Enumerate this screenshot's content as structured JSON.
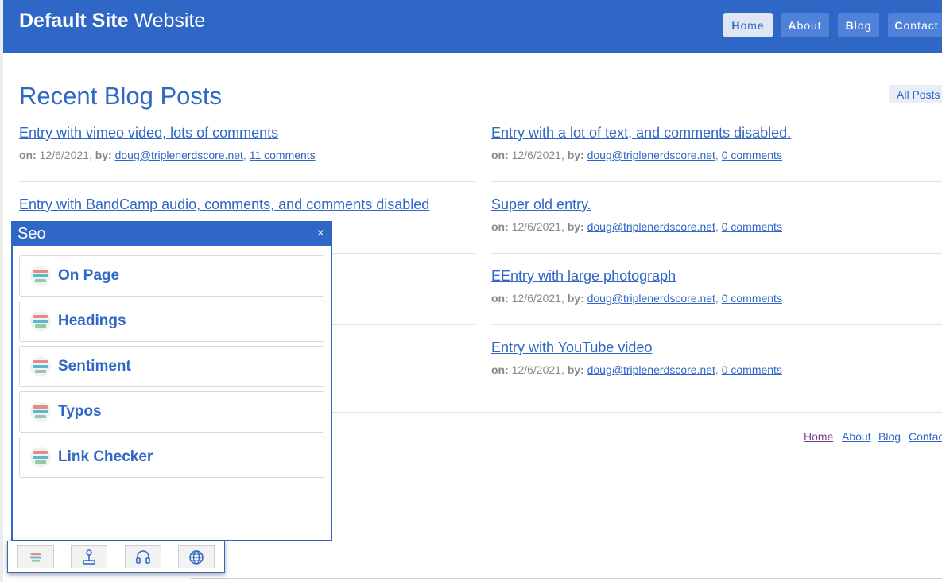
{
  "header": {
    "brand_bold": "Default Site",
    "brand_rest": "Website",
    "nav": [
      {
        "first": "H",
        "rest": "ome"
      },
      {
        "first": "A",
        "rest": "bout"
      },
      {
        "first": "B",
        "rest": "log"
      },
      {
        "first": "C",
        "rest": "ontact"
      }
    ]
  },
  "main": {
    "title": "Recent Blog Posts",
    "all_posts": "All Posts",
    "on_label": "on:",
    "by_label": "by:",
    "posts_left": [
      {
        "title": "Entry with vimeo video, lots of comments",
        "date": "12/6/2021,",
        "author": "doug@triplenerdscore.net",
        "comments": "11 comments"
      },
      {
        "title": "Entry with BandCamp audio, comments, and comments disabled",
        "date": "",
        "author": "",
        "comments": ""
      }
    ],
    "posts_right": [
      {
        "title": "Entry with a lot of text, and comments disabled.",
        "date": "12/6/2021,",
        "author": "doug@triplenerdscore.net",
        "comments": "0 comments"
      },
      {
        "title": "Super old entry.",
        "date": "12/6/2021,",
        "author": "doug@triplenerdscore.net",
        "comments": "0 comments"
      },
      {
        "title": "EEntry with large photograph",
        "date": "12/6/2021,",
        "author": "doug@triplenerdscore.net",
        "comments": "0 comments"
      },
      {
        "title": "Entry with YouTube video",
        "date": "12/6/2021,",
        "author": "doug@triplenerdscore.net",
        "comments": "0 comments"
      }
    ]
  },
  "footer": {
    "links": [
      "Home",
      "About",
      "Blog",
      "Contac"
    ]
  },
  "seo_panel": {
    "title": "Seo",
    "close": "×",
    "items": [
      "On Page",
      "Headings",
      "Sentiment",
      "Typos",
      "Link Checker"
    ],
    "toolbar_icons": [
      "hey-check-it-logo-icon",
      "joystick-icon",
      "headset-icon",
      "globe-icon"
    ]
  },
  "colors": {
    "brand_blue": "#2f67c6",
    "visited_link": "#7a3e8e"
  }
}
